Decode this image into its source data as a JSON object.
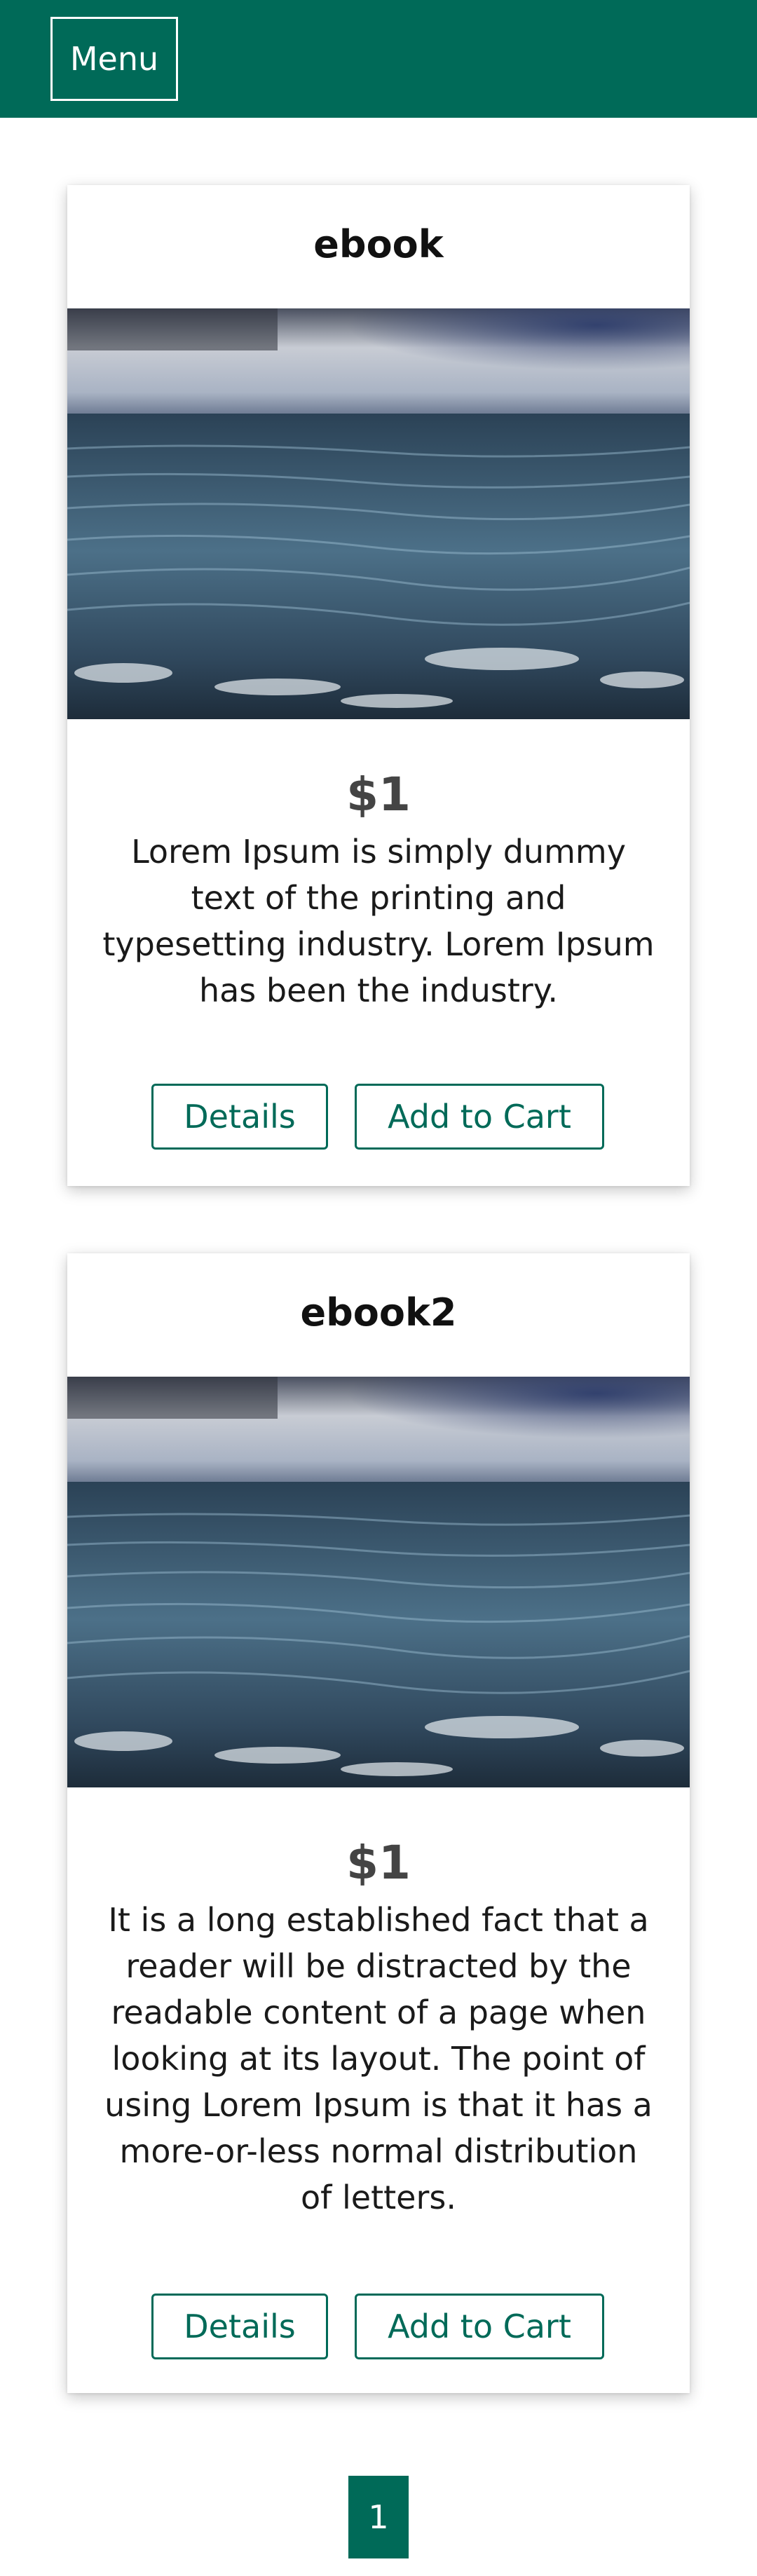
{
  "header": {
    "menu_label": "Menu",
    "brand_color": "#006a58"
  },
  "products": [
    {
      "title": "ebook",
      "price": "$1",
      "description": "Lorem Ipsum is simply dummy text of the printing and typesetting industry. Lorem Ipsum has been the industry.",
      "details_label": "Details",
      "cart_label": "Add to Cart",
      "image_icon": "sea-photo"
    },
    {
      "title": "ebook2",
      "price": "$1",
      "description": "It is a long established fact that a reader will be distracted by the readable content of a page when looking at its layout. The point of using Lorem Ipsum is that it has a more-or-less normal distribution of letters.",
      "details_label": "Details",
      "cart_label": "Add to Cart",
      "image_icon": "sea-photo"
    }
  ],
  "pagination": {
    "current_page": "1"
  }
}
